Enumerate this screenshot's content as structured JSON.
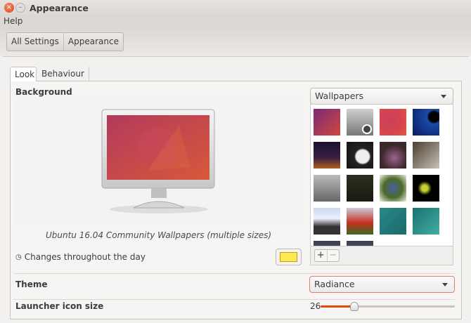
{
  "window": {
    "title": "Appearance"
  },
  "menu": {
    "help": "Help"
  },
  "breadcrumb": [
    "All Settings",
    "Appearance"
  ],
  "tabs": [
    "Look",
    "Behaviour"
  ],
  "background": {
    "label": "Background",
    "source": "Wallpapers",
    "caption": "Ubuntu 16.04 Community Wallpapers (multiple sizes)",
    "changes_label": "Changes throughout the day",
    "color": "#fce94f",
    "add_label": "+",
    "remove_label": "−"
  },
  "theme": {
    "label": "Theme",
    "value": "Radiance"
  },
  "launcher": {
    "label": "Launcher icon size",
    "value": "26",
    "fraction": 0.25
  },
  "colors": {
    "accent": "#dd4814"
  }
}
